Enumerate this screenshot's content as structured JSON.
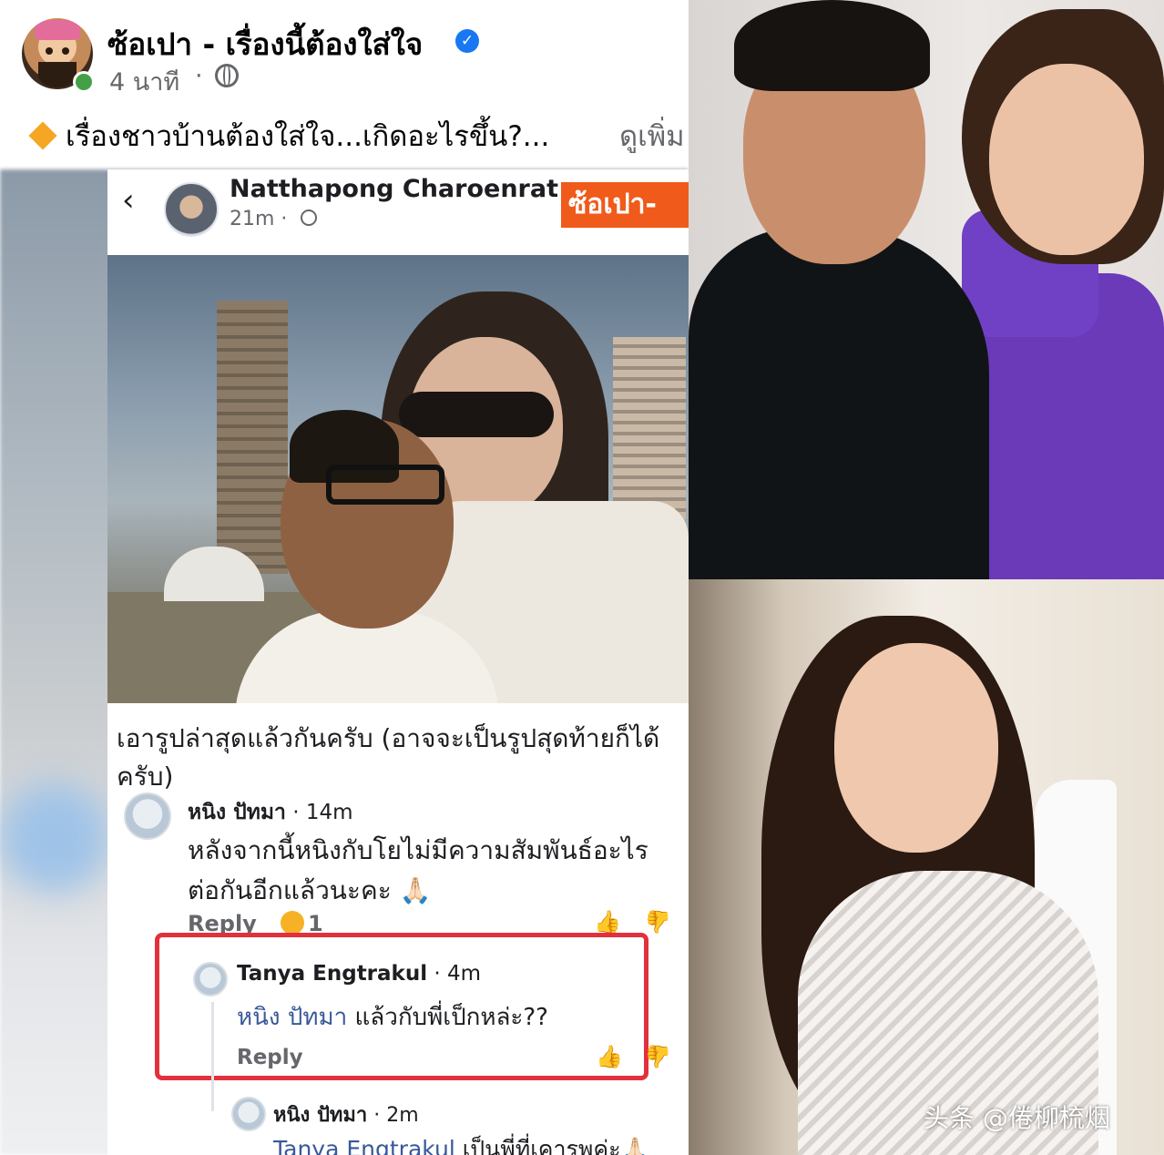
{
  "post": {
    "page_name": "ซ้อเปา - เรื่องนี้ต้องใส่ใจ",
    "time": "4 นาที",
    "dot": "·",
    "text": "เรื่องชาวบ้านต้องใส่ใจ...เกิดอะไรขึ้น?...",
    "see_more": "ดูเพิ่ม",
    "verified_glyph": "✓"
  },
  "shot": {
    "back_glyph": "‹",
    "author_name": "Natthapong Charoenrat",
    "author_time": "21m ·",
    "brand_badge": "ซ้อเปา-",
    "caption": "เอารูปล่าสุดแล้วกันครับ (อาจจะเป็นรูปสุดท้ายก็ได้ครับ)"
  },
  "comments": [
    {
      "name": "หนิง ปัทมา",
      "time": "· 14m",
      "text": "หลังจากนี้หนิงกับโยไม่มีความสัมพันธ์อะไรต่อกันอีกแล้วนะคะ 🙏🏻",
      "reply_label": "Reply",
      "reaction_count": "1"
    },
    {
      "name": "Tanya Engtrakul",
      "time": "· 4m",
      "mention": "หนิง ปัทมา",
      "text": " แล้วกับพี่เป็กหล่ะ??",
      "reply_label": "Reply"
    },
    {
      "name": "หนิง ปัทมา",
      "time": "· 2m",
      "mention": "Tanya Engtrakul",
      "text": " เป็นพี่ที่เคารพค่ะ🙏🏻"
    }
  ],
  "icons": {
    "thumb_glyph": "👍",
    "back": "chevron-left-icon",
    "globe": "globe-icon",
    "verified": "verified-badge-icon"
  },
  "watermark": "头条 @倦柳梳烟",
  "colors": {
    "facebook_blue": "#1877f2",
    "highlight_red": "#e3303d",
    "brand_orange": "#f05a1a",
    "mention_blue": "#385898"
  }
}
